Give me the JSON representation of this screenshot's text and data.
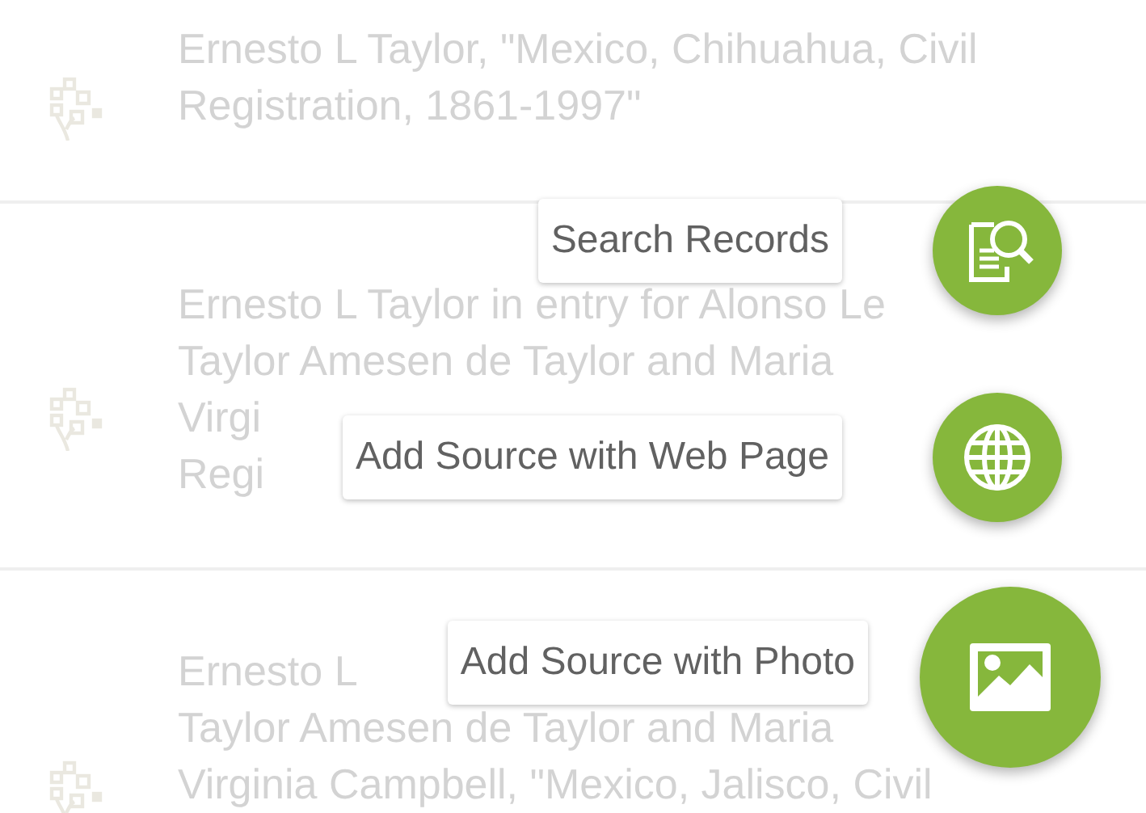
{
  "sources": [
    {
      "lines": [
        "Ernesto L Taylor, \"Mexico, Chihuahua, Civil",
        "Registration, 1861-1997\""
      ]
    },
    {
      "lines": [
        "Ernesto L Taylor in entry for Alonso Le",
        "Taylor Amesen de Taylor and Maria",
        "Virgi",
        "Regi"
      ]
    },
    {
      "lines": [
        "Ernesto L",
        "Taylor Amesen de Taylor and Maria",
        "Virginia Campbell, \"Mexico, Jalisco, Civil"
      ]
    }
  ],
  "fab_actions": [
    {
      "label": "Search Records",
      "kind": "search"
    },
    {
      "label": "Add Source with Web Page",
      "kind": "web"
    },
    {
      "label": "Add Source with Photo",
      "kind": "photo"
    }
  ]
}
